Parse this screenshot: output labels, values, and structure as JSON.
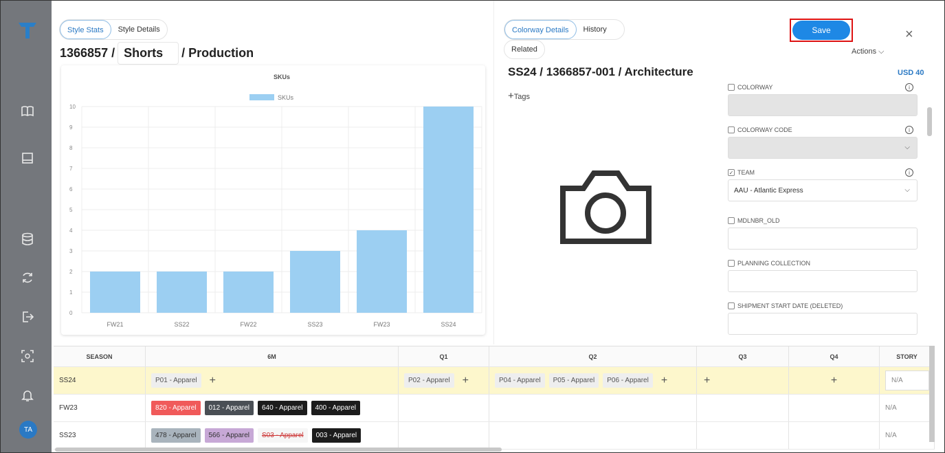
{
  "sidebar": {
    "icons": [
      "logo-icon",
      "book-icon",
      "inbox-icon",
      "database-icon",
      "sync-icon",
      "export-icon",
      "scan-icon",
      "bell-icon"
    ],
    "avatar_initials": "TA"
  },
  "left": {
    "tabs": [
      "Style Stats",
      "Style Details"
    ],
    "style_number": "1366857 /",
    "category": "Shorts",
    "stage": "/ Production"
  },
  "chart_data": {
    "type": "bar",
    "title": "SKUs",
    "legend": "SKUs",
    "legend_position": "top",
    "categories": [
      "FW21",
      "SS22",
      "FW22",
      "SS23",
      "FW23",
      "SS24"
    ],
    "values": [
      2,
      2,
      2,
      3,
      4,
      10
    ],
    "ylim": [
      0,
      10
    ],
    "yticks": [
      0,
      1,
      2,
      3,
      4,
      5,
      6,
      7,
      8,
      9,
      10
    ],
    "grid": true,
    "color": "#9ccff2"
  },
  "right": {
    "tabs": [
      "Colorway Details",
      "History",
      "Related"
    ],
    "save_label": "Save",
    "close_label": "×",
    "actions_label": "Actions",
    "colorway_title": "SS24 / 1366857-001 / Architecture",
    "price": "USD 40",
    "tags_label": "Tags",
    "fields": [
      {
        "label": "COLORWAY",
        "value": "",
        "checked": false,
        "info": true,
        "grey": true,
        "dropdown": false
      },
      {
        "label": "COLORWAY CODE",
        "value": "",
        "checked": false,
        "info": true,
        "grey": true,
        "dropdown": true
      },
      {
        "label": "TEAM",
        "value": "AAU - Atlantic Express",
        "checked": true,
        "info": true,
        "grey": false,
        "dropdown": true
      },
      {
        "label": "MDLNBR_OLD",
        "value": "",
        "checked": false,
        "info": false,
        "grey": false,
        "dropdown": false
      },
      {
        "label": "PLANNING COLLECTION",
        "value": "",
        "checked": false,
        "info": false,
        "grey": false,
        "dropdown": false
      },
      {
        "label": "SHIPMENT START DATE (DELETED)",
        "value": "",
        "checked": false,
        "info": false,
        "grey": false,
        "dropdown": false
      }
    ]
  },
  "table": {
    "headers": [
      "SEASON",
      "6M",
      "Q1",
      "Q2",
      "Q3",
      "Q4",
      "STORY"
    ],
    "rows": [
      {
        "season": "SS24",
        "m6": [
          {
            "label": "P01 - Apparel",
            "style": "light"
          }
        ],
        "q1": [
          {
            "label": "P02 - Apparel",
            "style": "light"
          }
        ],
        "q2": [
          {
            "label": "P04 - Apparel",
            "style": "light"
          },
          {
            "label": "P05 - Apparel",
            "style": "light"
          },
          {
            "label": "P06 - Apparel",
            "style": "light"
          }
        ],
        "story": "N/A"
      },
      {
        "season": "FW23",
        "m6": [
          {
            "label": "820 - Apparel",
            "style": "red"
          },
          {
            "label": "012 - Apparel",
            "style": "dark"
          },
          {
            "label": "640 - Apparel",
            "style": "black"
          },
          {
            "label": "400 - Apparel",
            "style": "black"
          }
        ],
        "story": "N/A"
      },
      {
        "season": "SS23",
        "m6": [
          {
            "label": "478 - Apparel",
            "style": "slate"
          },
          {
            "label": "566 - Apparel",
            "style": "purple"
          },
          {
            "label": "S03 - Apparel",
            "style": "strike"
          },
          {
            "label": "003 - Apparel",
            "style": "black"
          }
        ],
        "story": "N/A"
      }
    ],
    "highlight_color": "#fdf7cc",
    "chip_colors": {
      "light": "#eeeeee",
      "red": "#f05a5a",
      "dark": "#4a4f55",
      "black": "#1c1c1c",
      "slate": "#a9b4bd",
      "purple": "#c7a8d6",
      "strike": "#f6f6f6"
    }
  }
}
